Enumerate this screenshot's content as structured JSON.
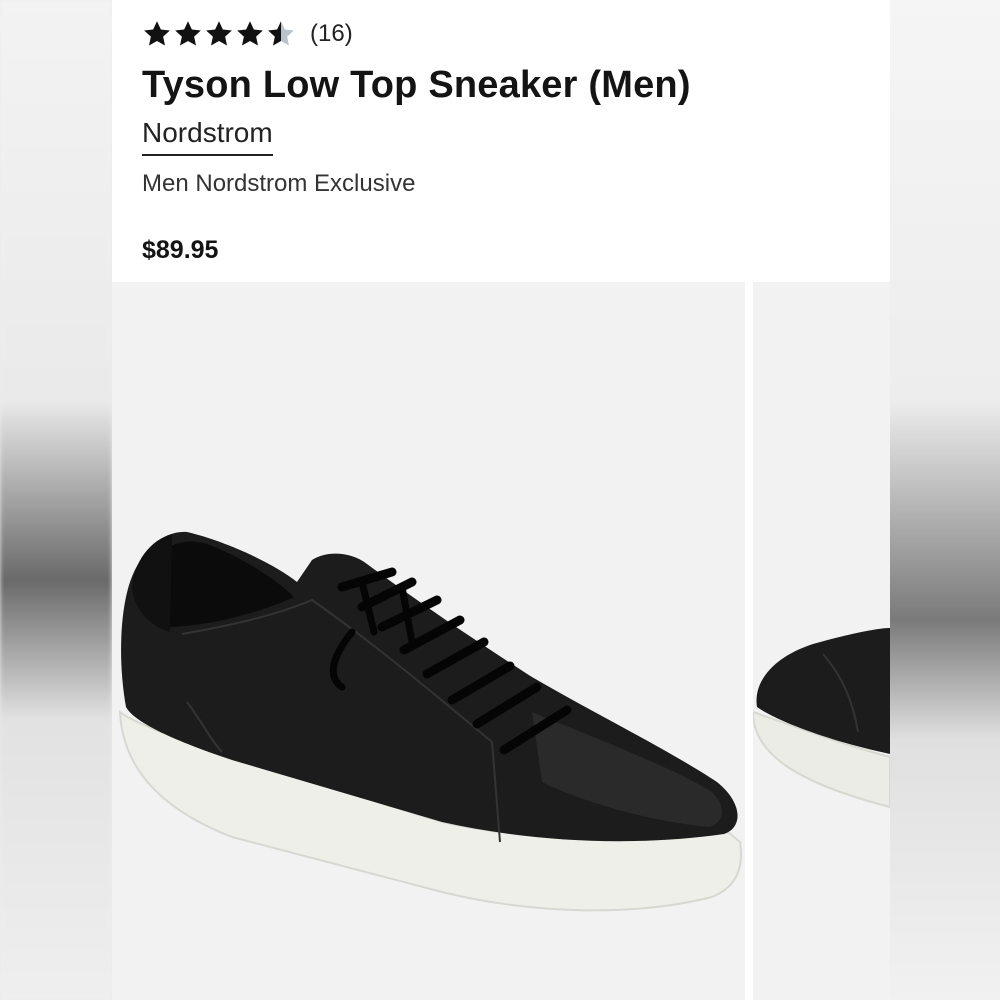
{
  "product": {
    "rating": 4.5,
    "review_count": "(16)",
    "title": "Tyson Low Top Sneaker (Men)",
    "brand": "Nordstrom",
    "subtitle": "Men Nordstrom Exclusive",
    "price": "$89.95"
  },
  "images": [
    {
      "icon": "black-leather-sneaker-side-view"
    },
    {
      "icon": "black-leather-sneaker-toe-view"
    }
  ],
  "colors": {
    "star_filled": "#111111",
    "star_empty": "#b9c3ca",
    "text": "#141414"
  }
}
